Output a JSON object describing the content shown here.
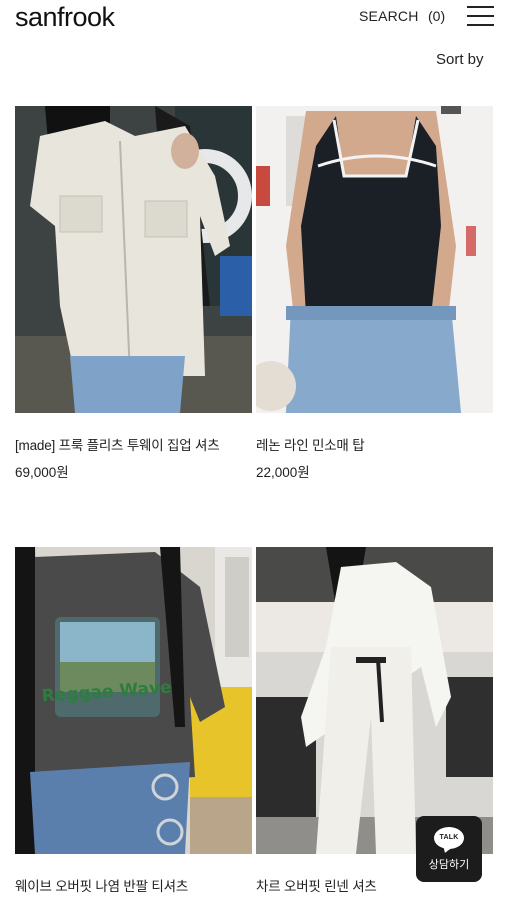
{
  "header": {
    "logo": "sanfrook",
    "search_label": "SEARCH",
    "cart_count": "(0)",
    "menu_icon": "hamburger-menu-icon"
  },
  "sort": {
    "label": "Sort by"
  },
  "products": [
    {
      "name": "[made] 프룩 플리츠 투웨이 집업 셔츠",
      "price": "69,000원",
      "image": "cream-zip-up-shirt-photo"
    },
    {
      "name": "레논 라인 민소매 탑",
      "price": "22,000원",
      "image": "black-line-sleeveless-top-photo"
    },
    {
      "name": "웨이브 오버핏 나염 반팔 티셔츠",
      "price": "",
      "image": "charcoal-print-tshirt-photo",
      "print_text": "Reggae Wave"
    },
    {
      "name": "차르 오버핏 린넨 셔츠",
      "price": "",
      "image": "white-linen-shirt-photo"
    }
  ],
  "talk": {
    "bubble_text": "TALK",
    "label": "상담하기"
  }
}
